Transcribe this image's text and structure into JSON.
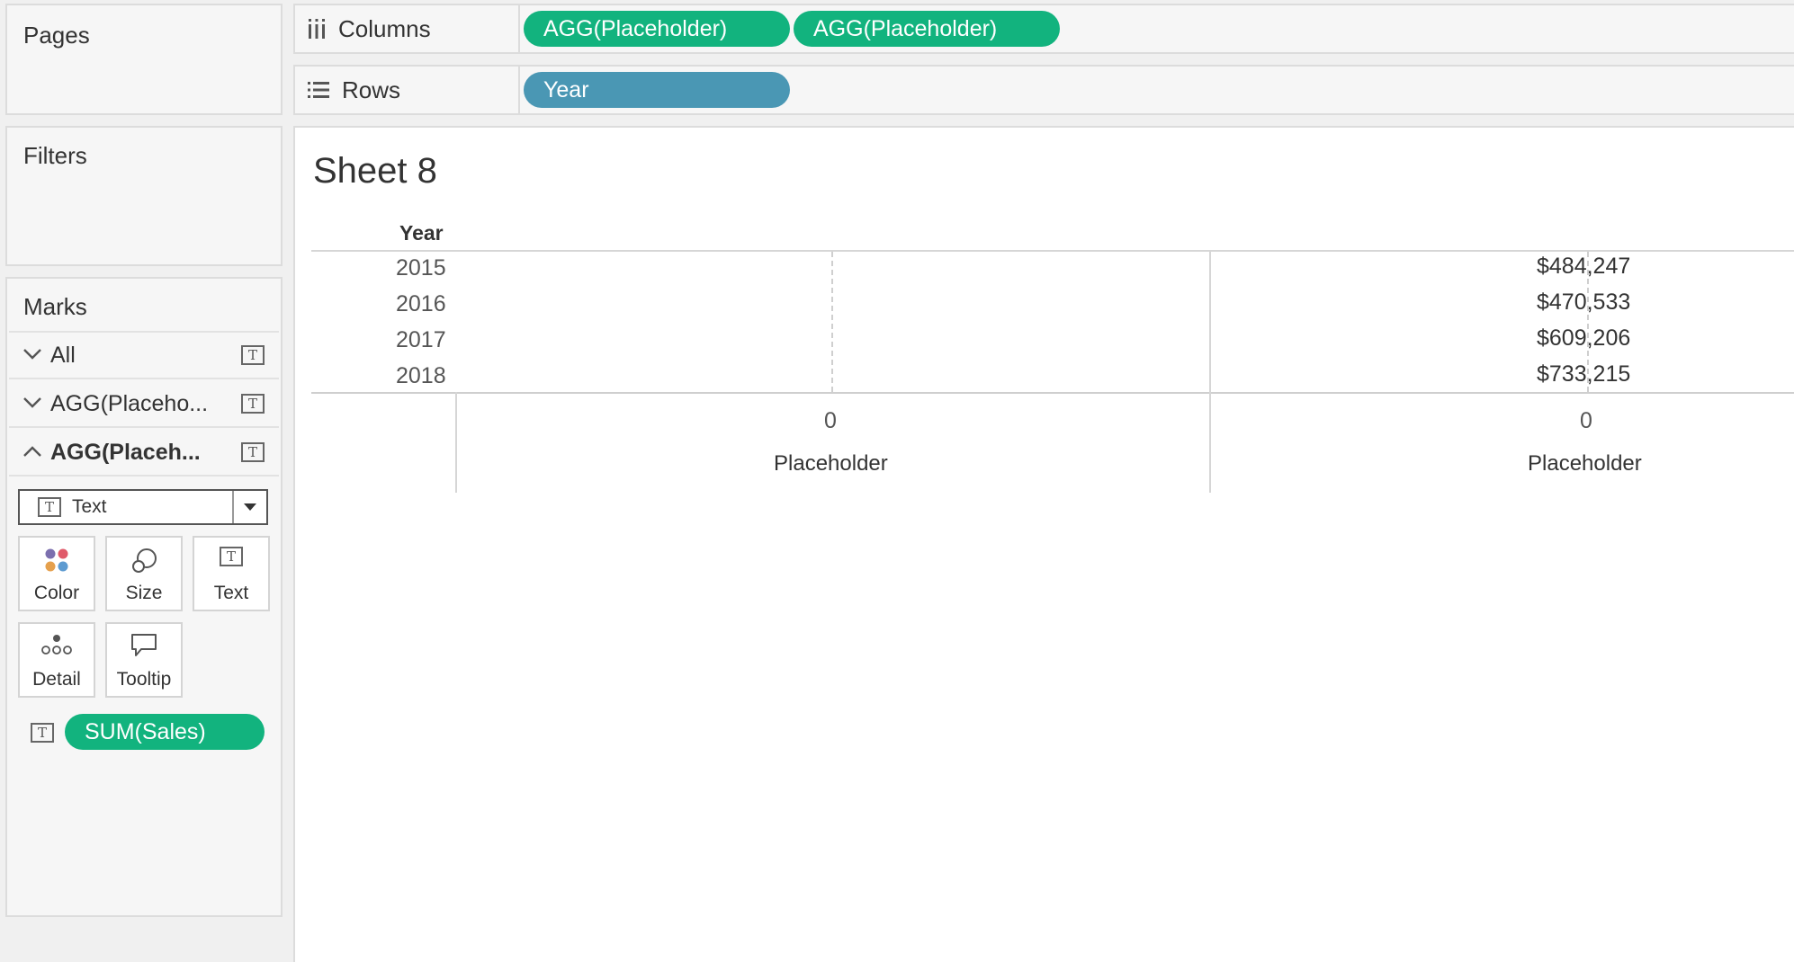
{
  "pages": {
    "title": "Pages"
  },
  "filters": {
    "title": "Filters"
  },
  "columns_shelf": {
    "label": "Columns",
    "icon": "columns-icon",
    "pills": [
      "AGG(Placeholder)",
      "AGG(Placeholder)"
    ]
  },
  "rows_shelf": {
    "label": "Rows",
    "icon": "rows-icon",
    "pills": [
      "Year"
    ]
  },
  "marks": {
    "title": "Marks",
    "rows": [
      {
        "label": "All",
        "chevron": "chevron-down-icon"
      },
      {
        "label": "AGG(Placeho...",
        "chevron": "chevron-down-icon"
      },
      {
        "label": "AGG(Placeh...",
        "chevron": "chevron-up-icon"
      }
    ],
    "mark_type": "Text",
    "cards": [
      "Color",
      "Size",
      "Text",
      "Detail",
      "Tooltip"
    ],
    "field_pill": "SUM(Sales)"
  },
  "sheet": {
    "title": "Sheet 8",
    "row_header": "Year",
    "years": [
      "2015",
      "2016",
      "2017",
      "2018"
    ],
    "values": [
      "$484,247",
      "$470,533",
      "$609,206",
      "$733,215"
    ],
    "axes": [
      {
        "tick": "0",
        "label": "Placeholder"
      },
      {
        "tick": "0",
        "label": "Placeholder"
      }
    ]
  },
  "colors": {
    "green_pill": "#12b37e",
    "blue_pill": "#4a97b4"
  }
}
